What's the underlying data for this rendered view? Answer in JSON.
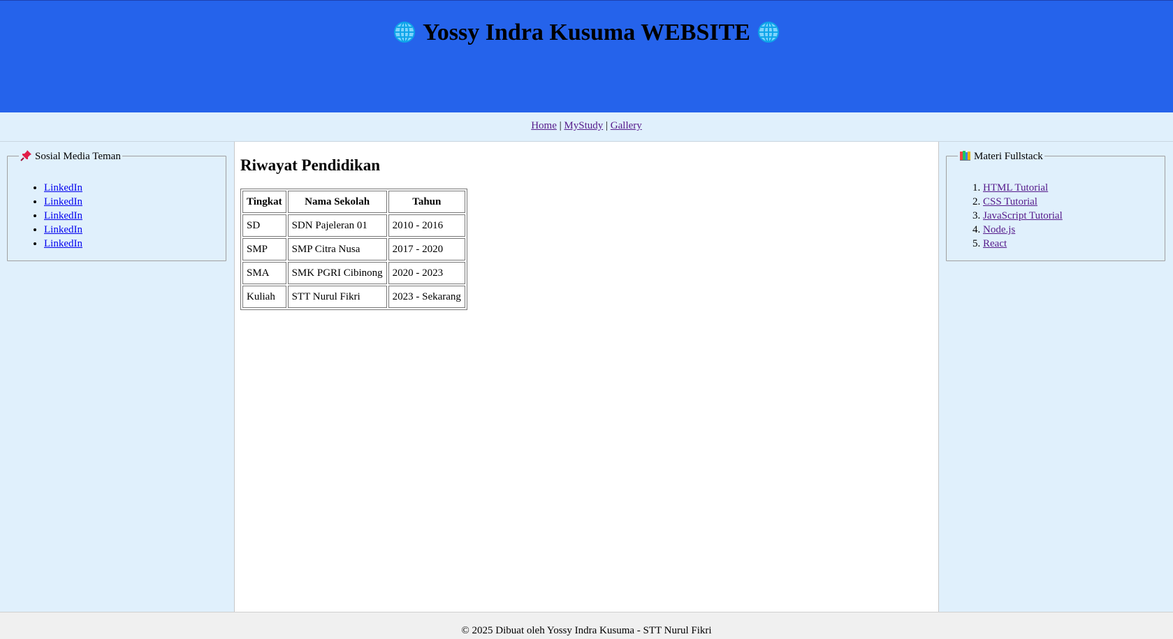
{
  "header": {
    "title": "Yossy Indra Kusuma WEBSITE",
    "left_icon": "globe-icon",
    "right_icon": "globe-icon"
  },
  "nav": {
    "items": [
      {
        "label": "Home"
      },
      {
        "label": "MyStudy"
      },
      {
        "label": "Gallery"
      }
    ],
    "separator": "|"
  },
  "left_panel": {
    "legend": "Sosial Media Teman",
    "legend_icon": "pushpin-icon",
    "links": [
      {
        "label": "LinkedIn"
      },
      {
        "label": "LinkedIn"
      },
      {
        "label": "LinkedIn"
      },
      {
        "label": "LinkedIn"
      },
      {
        "label": "LinkedIn"
      }
    ]
  },
  "main": {
    "heading": "Riwayat Pendidikan",
    "table": {
      "headers": [
        "Tingkat",
        "Nama Sekolah",
        "Tahun"
      ],
      "rows": [
        [
          "SD",
          "SDN Pajeleran 01",
          "2010 - 2016"
        ],
        [
          "SMP",
          "SMP Citra Nusa",
          "2017 - 2020"
        ],
        [
          "SMA",
          "SMK PGRI Cibinong",
          "2020 - 2023"
        ],
        [
          "Kuliah",
          "STT Nurul Fikri",
          "2023 - Sekarang"
        ]
      ]
    }
  },
  "right_panel": {
    "legend": "Materi Fullstack",
    "legend_icon": "books-icon",
    "links": [
      {
        "label": "HTML Tutorial"
      },
      {
        "label": "CSS Tutorial"
      },
      {
        "label": "JavaScript Tutorial"
      },
      {
        "label": "Node.js"
      },
      {
        "label": "React"
      }
    ]
  },
  "footer": {
    "text": "© 2025 Dibuat oleh Yossy Indra Kusuma - STT Nurul Fikri"
  },
  "colors": {
    "header_bg": "#2563eb",
    "sidebar_bg": "#e0f0fc",
    "footer_bg": "#f0f0f0",
    "globe": "#38bdf8"
  }
}
